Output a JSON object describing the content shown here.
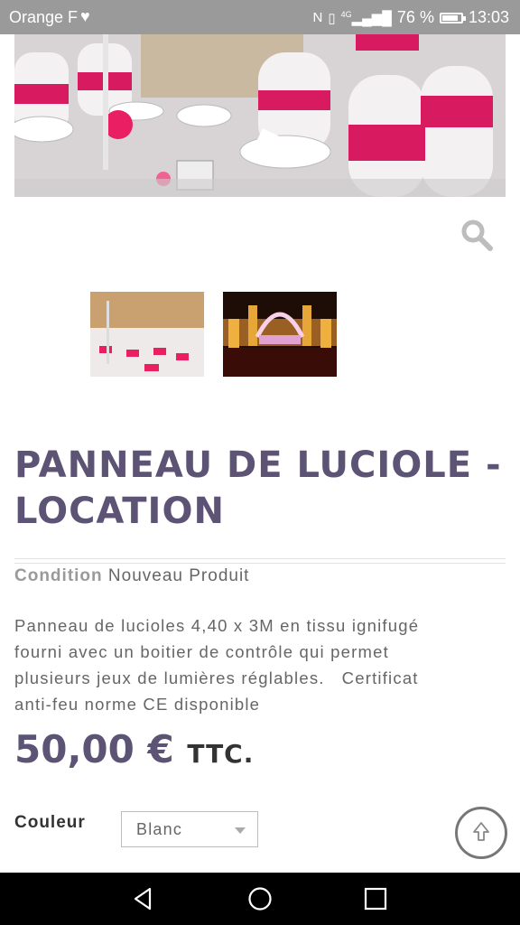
{
  "status_bar": {
    "carrier": "Orange F",
    "network": "4G",
    "battery_percent": "76 %",
    "battery_level": 0.76,
    "time": "13:03"
  },
  "product": {
    "title_line1": "PANNEAU DE LUCIOLE -",
    "title_line2": "LOCATION",
    "condition_label": "Condition",
    "condition_value": "Nouveau Produit",
    "description_lines": [
      "Panneau de lucioles 4,40 x 3M en tissu ignifugé",
      "fourni avec un boitier de contrôle qui permet",
      "plusieurs jeux de lumières réglables.   Certificat",
      "anti-feu norme CE disponible"
    ],
    "price": "50,00 €",
    "price_suffix": "TTC.",
    "color_label": "Couleur",
    "color_selected": "Blanc"
  },
  "icons": {
    "zoom": "search-icon",
    "scroll_top": "arrow-up-icon",
    "nav_back": "triangle-back-icon",
    "nav_home": "circle-home-icon",
    "nav_recent": "square-recent-icon"
  },
  "colors": {
    "accent": "#5d5375",
    "status_bar": "#9a9a9a",
    "nav_bar": "#000000"
  }
}
